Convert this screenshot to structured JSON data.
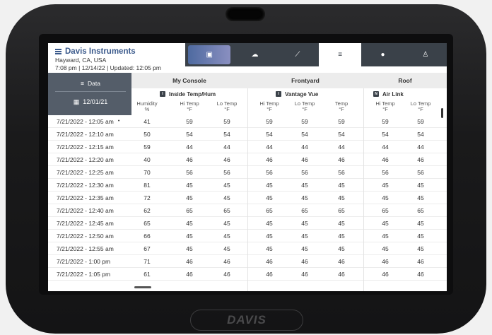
{
  "device": {
    "logo": "DAVIS"
  },
  "header": {
    "title": "Davis Instruments",
    "location": "Hayward, CA, USA",
    "updated": "7:08 pm | 12/14/22 | Updated: 12:05 pm"
  },
  "tabs": [
    {
      "icon": "dashboard-icon",
      "glyph": "▣",
      "active": false
    },
    {
      "icon": "cloud-icon",
      "glyph": "☁",
      "active": false
    },
    {
      "icon": "chart-icon",
      "glyph": "⟋",
      "active": false
    },
    {
      "icon": "list-icon",
      "glyph": "≡",
      "active": true
    },
    {
      "icon": "location-icon",
      "glyph": "●",
      "active": false
    },
    {
      "icon": "person-icon",
      "glyph": "♙",
      "active": false
    }
  ],
  "sidebar": {
    "data_label": "Data",
    "date_label": "12/01/21"
  },
  "sections": [
    {
      "name": "My Console",
      "station": "Inside Temp/Hum",
      "badge": "I"
    },
    {
      "name": "Frontyard",
      "station": "Vantage Vue",
      "badge": "I"
    },
    {
      "name": "Roof",
      "station": "Air Link",
      "badge": "N"
    }
  ],
  "columns": [
    {
      "label": "Humidity",
      "unit": "%"
    },
    {
      "label": "Hi Temp",
      "unit": "°F"
    },
    {
      "label": "Lo Temp",
      "unit": "°F"
    },
    {
      "label": "Hi Temp",
      "unit": "°F"
    },
    {
      "label": "Lo Temp",
      "unit": "°F"
    },
    {
      "label": "Temp",
      "unit": "°F"
    },
    {
      "label": "Hi Temp",
      "unit": "°F"
    },
    {
      "label": "Lo Temp",
      "unit": "°F"
    }
  ],
  "rows": [
    {
      "time": "7/21/2022 - 12:05 am",
      "marker": "•",
      "values": [
        "41",
        "59",
        "59",
        "59",
        "59",
        "59",
        "59",
        "59"
      ]
    },
    {
      "time": "7/21/2022 - 12:10 am",
      "values": [
        "50",
        "54",
        "54",
        "54",
        "54",
        "54",
        "54",
        "54"
      ]
    },
    {
      "time": "7/21/2022 - 12:15 am",
      "values": [
        "59",
        "44",
        "44",
        "44",
        "44",
        "44",
        "44",
        "44"
      ]
    },
    {
      "time": "7/21/2022 - 12:20 am",
      "values": [
        "40",
        "46",
        "46",
        "46",
        "46",
        "46",
        "46",
        "46"
      ]
    },
    {
      "time": "7/21/2022 - 12:25 am",
      "values": [
        "70",
        "56",
        "56",
        "56",
        "56",
        "56",
        "56",
        "56"
      ]
    },
    {
      "time": "7/21/2022 - 12:30 am",
      "values": [
        "81",
        "45",
        "45",
        "45",
        "45",
        "45",
        "45",
        "45"
      ]
    },
    {
      "time": "7/21/2022 - 12:35 am",
      "values": [
        "72",
        "45",
        "45",
        "45",
        "45",
        "45",
        "45",
        "45"
      ]
    },
    {
      "time": "7/21/2022 - 12:40 am",
      "values": [
        "62",
        "65",
        "65",
        "65",
        "65",
        "65",
        "65",
        "65"
      ]
    },
    {
      "time": "7/21/2022 - 12:45 am",
      "values": [
        "65",
        "45",
        "45",
        "45",
        "45",
        "45",
        "45",
        "45"
      ]
    },
    {
      "time": "7/21/2022 - 12:50 am",
      "values": [
        "66",
        "45",
        "45",
        "45",
        "45",
        "45",
        "45",
        "45"
      ]
    },
    {
      "time": "7/21/2022 - 12:55 am",
      "values": [
        "67",
        "45",
        "45",
        "45",
        "45",
        "45",
        "45",
        "45"
      ]
    },
    {
      "time": "7/21/2022 - 1:00 pm",
      "values": [
        "71",
        "46",
        "46",
        "46",
        "46",
        "46",
        "46",
        "46"
      ]
    },
    {
      "time": "7/21/2022 - 1:05 pm",
      "values": [
        "61",
        "46",
        "46",
        "46",
        "46",
        "46",
        "46",
        "46"
      ]
    }
  ]
}
